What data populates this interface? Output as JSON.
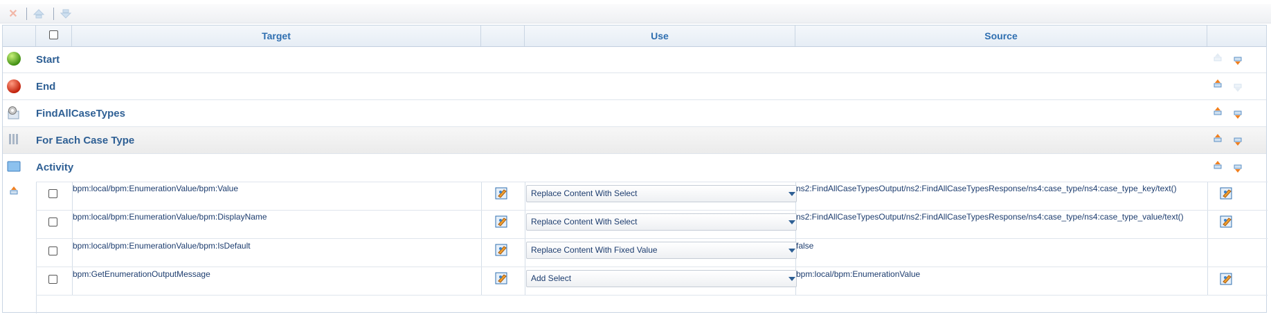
{
  "toolbar": {
    "delete_icon": "x-icon",
    "up_icon": "move-up-icon",
    "down_icon": "move-down-icon"
  },
  "header": {
    "target": "Target",
    "use": "Use",
    "source": "Source"
  },
  "sections": [
    {
      "label": "Start",
      "icon": "start-green-icon"
    },
    {
      "label": "End",
      "icon": "end-red-icon"
    },
    {
      "label": "FindAllCaseTypes",
      "icon": "service-gear-icon"
    },
    {
      "label": "For Each Case Type",
      "icon": "loop-icon"
    },
    {
      "label": "Activity",
      "icon": "activity-icon"
    }
  ],
  "mappings": [
    {
      "target": "bpm:local/bpm:EnumerationValue/bpm:Value",
      "use": "Replace Content With Select",
      "source": "ns2:FindAllCaseTypesOutput/ns2:FindAllCaseTypesResponse/ns4:case_type/ns4:case_type_key/text()"
    },
    {
      "target": "bpm:local/bpm:EnumerationValue/bpm:DisplayName",
      "use": "Replace Content With Select",
      "source": "ns2:FindAllCaseTypesOutput/ns2:FindAllCaseTypesResponse/ns4:case_type/ns4:case_type_value/text()"
    },
    {
      "target": "bpm:local/bpm:EnumerationValue/bpm:IsDefault",
      "use": "Replace Content With Fixed Value",
      "source": "false"
    },
    {
      "target": "bpm:GetEnumerationOutputMessage",
      "use": "Add Select",
      "source": "bpm:local/bpm:EnumerationValue"
    }
  ]
}
